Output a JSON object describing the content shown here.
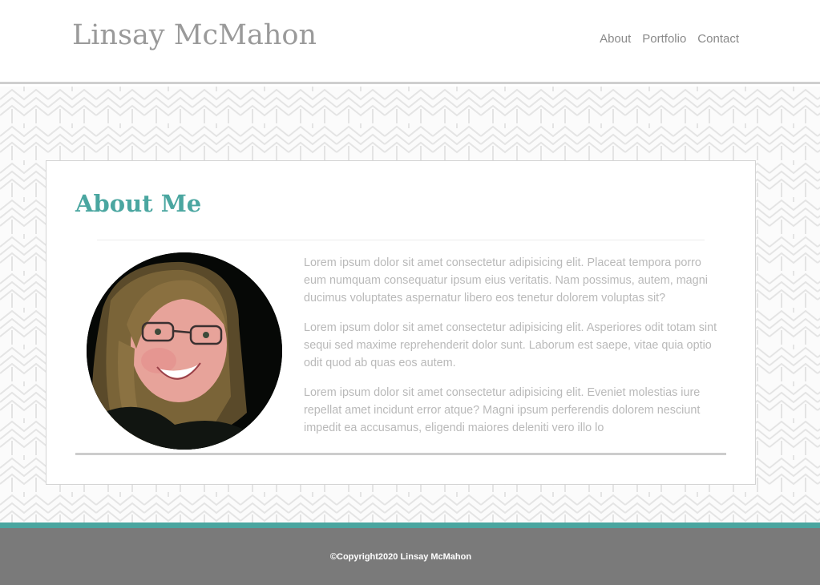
{
  "header": {
    "site_title": "Linsay McMahon",
    "nav": [
      {
        "label": "About"
      },
      {
        "label": "Portfolio"
      },
      {
        "label": "Contact"
      }
    ]
  },
  "about": {
    "heading": "About Me",
    "paragraphs": [
      "Lorem ipsum dolor sit amet consectetur adipisicing elit. Placeat tempora porro eum numquam consequatur ipsum eius veritatis. Nam possimus, autem, magni ducimus voluptates aspernatur libero eos tenetur dolorem voluptas sit?",
      "Lorem ipsum dolor sit amet consectetur adipisicing elit. Asperiores odit totam sint sequi sed maxime reprehenderit dolor sunt. Laborum est saepe, vitae quia optio odit quod ab quas eos autem.",
      "Lorem ipsum dolor sit amet consectetur adipisicing elit. Eveniet molestias iure repellat amet incidunt error atque? Magni ipsum perferendis dolorem nesciunt impedit ea accusamus, eligendi maiores deleniti vero illo lo"
    ]
  },
  "footer": {
    "copyright": "©Copyright2020 Linsay McMahon"
  },
  "colors": {
    "accent": "#4aa6a0",
    "footer_bg": "#7a7a7a",
    "title_gray": "#9a9a9a",
    "body_text": "#b9b9b9"
  }
}
